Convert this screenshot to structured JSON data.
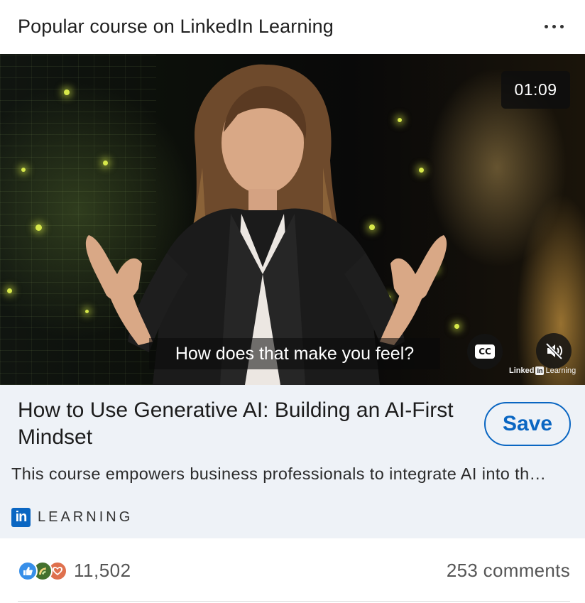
{
  "header": {
    "title": "Popular course on LinkedIn Learning",
    "more_icon": "more-horizontal-icon"
  },
  "video": {
    "duration": "01:09",
    "caption": "How does that make you feel?",
    "cc_label": "CC",
    "mute_icon": "speaker-muted-icon",
    "watermark": {
      "brand_bold": "Linked",
      "brand_in": "in",
      "brand_text": "Learning"
    }
  },
  "course": {
    "title": "How to Use Generative AI: Building an AI-First Mindset",
    "description": "This course empowers business professionals to integrate AI into th…",
    "save_label": "Save",
    "provider_logo": "in",
    "provider_label": "LEARNING"
  },
  "social": {
    "reactions": [
      "like-icon",
      "celebrate-icon",
      "love-icon"
    ],
    "reaction_count": "11,502",
    "comments": "253 comments"
  },
  "colors": {
    "accent": "#0a66c2",
    "info_bg": "#eef2f7",
    "like": "#378fe9",
    "celebrate": "#44712e",
    "love": "#df704d"
  }
}
